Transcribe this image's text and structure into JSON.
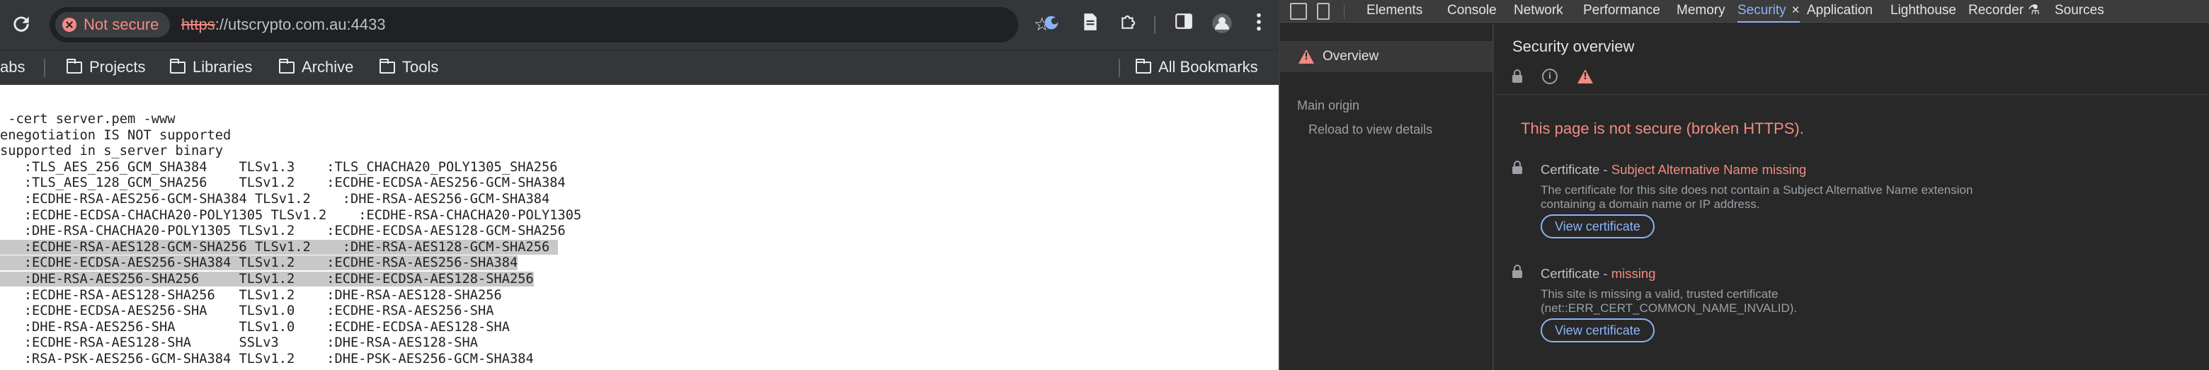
{
  "omnibox": {
    "security_chip": "Not secure",
    "url_scheme": "https",
    "url_rest": "://utscrypto.com.au:4433"
  },
  "bookmarks": {
    "partial_left": "abs",
    "items": [
      {
        "label": "Projects"
      },
      {
        "label": "Libraries"
      },
      {
        "label": "Archive"
      },
      {
        "label": "Tools"
      }
    ],
    "all_bookmarks": "All Bookmarks"
  },
  "terminal": {
    "lines": [
      {
        "text": " -cert server.pem -www"
      },
      {
        "text": "enegotiation IS NOT supported"
      },
      {
        "text": "supported in s_server binary"
      },
      {
        "text": "   :TLS_AES_256_GCM_SHA384    TLSv1.3    :TLS_CHACHA20_POLY1305_SHA256"
      },
      {
        "text": "   :TLS_AES_128_GCM_SHA256    TLSv1.2    :ECDHE-ECDSA-AES256-GCM-SHA384"
      },
      {
        "text": "   :ECDHE-RSA-AES256-GCM-SHA384 TLSv1.2    :DHE-RSA-AES256-GCM-SHA384"
      },
      {
        "text": "   :ECDHE-ECDSA-CHACHA20-POLY1305 TLSv1.2    :ECDHE-RSA-CHACHA20-POLY1305"
      },
      {
        "text": "   :DHE-RSA-CHACHA20-POLY1305 TLSv1.2    :ECDHE-ECDSA-AES128-GCM-SHA256 "
      },
      {
        "text": "   :ECDHE-RSA-AES128-GCM-SHA256 TLSv1.2    :DHE-RSA-AES128-GCM-SHA256 ",
        "highlight": true
      },
      {
        "text": "   :ECDHE-ECDSA-AES256-SHA384 TLSv1.2    :ECDHE-RSA-AES256-SHA384",
        "highlight": true
      },
      {
        "text": "   :DHE-RSA-AES256-SHA256     TLSv1.2    :ECDHE-ECDSA-AES128-SHA256",
        "highlight": true
      },
      {
        "text": "   :ECDHE-RSA-AES128-SHA256   TLSv1.2    :DHE-RSA-AES128-SHA256"
      },
      {
        "text": "   :ECDHE-ECDSA-AES256-SHA    TLSv1.0    :ECDHE-RSA-AES256-SHA"
      },
      {
        "text": "   :DHE-RSA-AES256-SHA        TLSv1.0    :ECDHE-ECDSA-AES128-SHA"
      },
      {
        "text": "   :ECDHE-RSA-AES128-SHA      SSLv3      :DHE-RSA-AES128-SHA"
      },
      {
        "text": "   :RSA-PSK-AES256-GCM-SHA384 TLSv1.2    :DHE-PSK-AES256-GCM-SHA384"
      }
    ]
  },
  "devtools": {
    "tabs": [
      {
        "label": "Elements",
        "name": "tab-elements"
      },
      {
        "label": "Console",
        "name": "tab-console"
      },
      {
        "label": "Network",
        "name": "tab-network"
      },
      {
        "label": "Performance",
        "name": "tab-performance"
      },
      {
        "label": "Memory",
        "name": "tab-memory"
      },
      {
        "label": "Security",
        "name": "tab-security",
        "active": true
      },
      {
        "label": "Application",
        "name": "tab-application"
      },
      {
        "label": "Lighthouse",
        "name": "tab-lighthouse"
      },
      {
        "label": "Recorder",
        "name": "tab-recorder"
      },
      {
        "label": "Sources",
        "name": "tab-sources"
      }
    ],
    "sidebar": {
      "overview": "Overview",
      "main_origin": "Main origin",
      "reload": "Reload to view details"
    },
    "main": {
      "title": "Security overview",
      "headline": "This page is not secure (broken HTTPS).",
      "certs": [
        {
          "label": "Certificate",
          "dash": " - ",
          "status": "Subject Alternative Name missing",
          "desc": "The certificate for this site does not contain a Subject Alternative Name extension containing a domain name or IP address.",
          "button": "View certificate"
        },
        {
          "label": "Certificate",
          "dash": " - ",
          "status": "missing",
          "desc": "This site is missing a valid, trusted certificate (net::ERR_CERT_COMMON_NAME_INVALID).",
          "button": "View certificate"
        }
      ]
    }
  },
  "colors": {
    "warning": "#f28b82",
    "accent": "#8ab4f8",
    "devtools_bg": "#282828",
    "toolbar_bg": "#35363a"
  }
}
